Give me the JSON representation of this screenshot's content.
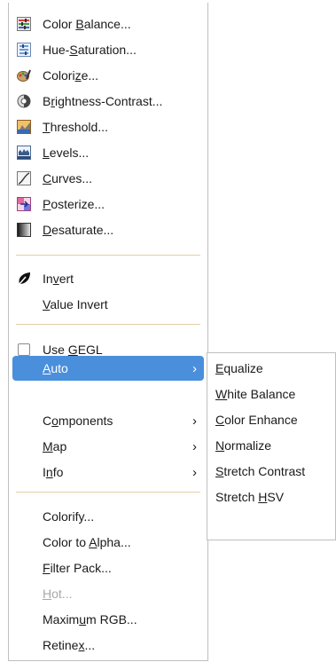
{
  "main_menu": {
    "items": [
      {
        "name": "color-balance",
        "parts": [
          "Color ",
          "B",
          "alance..."
        ],
        "icon": "color-balance-icon"
      },
      {
        "name": "hue-saturation",
        "parts": [
          "Hue-",
          "S",
          "aturation..."
        ],
        "icon": "hue-saturation-icon"
      },
      {
        "name": "colorize",
        "parts": [
          "Colori",
          "z",
          "e..."
        ],
        "icon": "colorize-icon"
      },
      {
        "name": "brightness-contrast",
        "parts": [
          "B",
          "r",
          "ightness-Contrast..."
        ],
        "icon": "brightness-contrast-icon"
      },
      {
        "name": "threshold",
        "parts": [
          "",
          "T",
          "hreshold..."
        ],
        "icon": "threshold-icon"
      },
      {
        "name": "levels",
        "parts": [
          "",
          "L",
          "evels..."
        ],
        "icon": "levels-icon"
      },
      {
        "name": "curves",
        "parts": [
          "",
          "C",
          "urves..."
        ],
        "icon": "curves-icon"
      },
      {
        "name": "posterize",
        "parts": [
          "",
          "P",
          "osterize..."
        ],
        "icon": "posterize-icon"
      },
      {
        "name": "desaturate",
        "parts": [
          "",
          "D",
          "esaturate..."
        ],
        "icon": "desaturate-icon"
      },
      {
        "name": "invert",
        "parts": [
          "In",
          "v",
          "ert"
        ],
        "icon": "invert-icon"
      },
      {
        "name": "value-invert",
        "parts": [
          "",
          "V",
          "alue Invert"
        ]
      },
      {
        "name": "use-gegl",
        "parts": [
          "Use ",
          "G",
          "EGL"
        ],
        "checked": false
      },
      {
        "name": "auto",
        "parts": [
          "",
          "A",
          "uto"
        ],
        "submenu": true,
        "highlighted": true
      },
      {
        "name": "components",
        "parts": [
          "C",
          "o",
          "mponents"
        ],
        "submenu": true
      },
      {
        "name": "map",
        "parts": [
          "",
          "M",
          "ap"
        ],
        "submenu": true
      },
      {
        "name": "info",
        "parts": [
          "I",
          "n",
          "fo"
        ],
        "submenu": true
      },
      {
        "name": "colorify",
        "parts": [
          "Colorify...",
          "",
          ""
        ]
      },
      {
        "name": "color-to-alpha",
        "parts": [
          "Color to ",
          "A",
          "lpha..."
        ]
      },
      {
        "name": "filter-pack",
        "parts": [
          "",
          "F",
          "ilter Pack..."
        ]
      },
      {
        "name": "hot",
        "parts": [
          "",
          "H",
          "ot..."
        ],
        "disabled": true
      },
      {
        "name": "maximum-rgb",
        "parts": [
          "Maxim",
          "u",
          "m RGB..."
        ]
      },
      {
        "name": "retinex",
        "parts": [
          "Retine",
          "x",
          "..."
        ]
      }
    ],
    "submenu_arrow": "›"
  },
  "auto_submenu": {
    "items": [
      {
        "name": "equalize",
        "parts": [
          "",
          "E",
          "qualize"
        ]
      },
      {
        "name": "white-balance",
        "parts": [
          "",
          "W",
          "hite Balance"
        ]
      },
      {
        "name": "color-enhance",
        "parts": [
          "",
          "C",
          "olor Enhance"
        ]
      },
      {
        "name": "normalize",
        "parts": [
          "",
          "N",
          "ormalize"
        ]
      },
      {
        "name": "stretch-contrast",
        "parts": [
          "",
          "S",
          "tretch Contrast"
        ]
      },
      {
        "name": "stretch-hsv",
        "parts": [
          "Stretch ",
          "H",
          "SV"
        ]
      }
    ]
  },
  "colors": {
    "highlight": "#4a8fdc",
    "separator": "#e4cfa9",
    "disabled_text": "#a8a8a8",
    "border": "#bfbfbf"
  }
}
